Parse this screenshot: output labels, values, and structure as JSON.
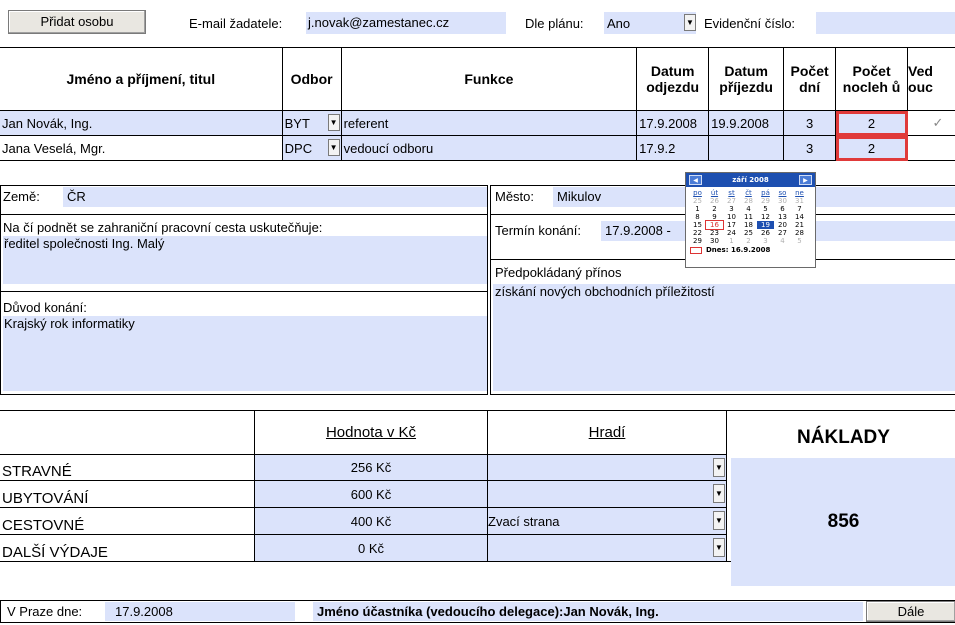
{
  "top": {
    "add_person_label": "Přidat osobu",
    "email_label": "E-mail žadatele:",
    "email_value": "j.novak@zamestanec.cz",
    "plan_label": "Dle plánu:",
    "plan_value": "Ano",
    "record_label": "Evidenční číslo:",
    "record_value": ""
  },
  "people": {
    "headers": {
      "name": "Jméno a příjmení, titul",
      "dept": "Odbor",
      "role": "Funkce",
      "depart_1": "Datum",
      "depart_2": "odjezdu",
      "arrive_1": "Datum",
      "arrive_2": "příjezdu",
      "days_1": "Počet",
      "days_2": "dní",
      "nights_1": "Počet",
      "nights_2": "nocleh ů",
      "last_1": "Ved",
      "last_2": "ouc"
    },
    "rows": [
      {
        "name": "Jan Novák, Ing.",
        "dept": "BYT",
        "role": "referent",
        "depart": "17.9.2008",
        "arrive": "19.9.2008",
        "days": "3",
        "nights": "2",
        "check": "✓"
      },
      {
        "name": "Jana Veselá, Mgr.",
        "dept": "DPC",
        "role": "vedoucí odboru",
        "depart": "17.9.2",
        "arrive": "",
        "days": "3",
        "nights": "2",
        "check": ""
      }
    ]
  },
  "calendar": {
    "month": "září 2008",
    "weekdays": [
      "po",
      "út",
      "st",
      "čt",
      "pá",
      "so",
      "ne"
    ],
    "days": [
      [
        "25",
        "g"
      ],
      [
        "26",
        "g"
      ],
      [
        "27",
        "g"
      ],
      [
        "28",
        "g"
      ],
      [
        "29",
        "g"
      ],
      [
        "30",
        "g"
      ],
      [
        "31",
        "g"
      ],
      [
        "1",
        ""
      ],
      [
        "2",
        ""
      ],
      [
        "3",
        ""
      ],
      [
        "4",
        ""
      ],
      [
        "5",
        ""
      ],
      [
        "6",
        ""
      ],
      [
        "7",
        ""
      ],
      [
        "8",
        ""
      ],
      [
        "9",
        ""
      ],
      [
        "10",
        ""
      ],
      [
        "11",
        ""
      ],
      [
        "12",
        ""
      ],
      [
        "13",
        ""
      ],
      [
        "14",
        ""
      ],
      [
        "15",
        ""
      ],
      [
        "16",
        "t"
      ],
      [
        "17",
        ""
      ],
      [
        "18",
        ""
      ],
      [
        "19",
        "s"
      ],
      [
        "20",
        ""
      ],
      [
        "21",
        ""
      ],
      [
        "22",
        ""
      ],
      [
        "23",
        ""
      ],
      [
        "24",
        ""
      ],
      [
        "25",
        ""
      ],
      [
        "26",
        ""
      ],
      [
        "27",
        ""
      ],
      [
        "28",
        ""
      ],
      [
        "29",
        ""
      ],
      [
        "30",
        ""
      ],
      [
        "1",
        "g"
      ],
      [
        "2",
        "g"
      ],
      [
        "3",
        "g"
      ],
      [
        "4",
        "g"
      ],
      [
        "5",
        "g"
      ]
    ],
    "today_label": "Dnes: 16.9.2008"
  },
  "trip": {
    "country_label": "Země:",
    "country_value": "ČR",
    "city_label": "Město:",
    "city_value": "Mikulov",
    "initiator_label": "Na čí podnět se zahraniční pracovní cesta uskutečňuje:",
    "initiator_value": "ředitel společnosti Ing. Malý",
    "term_label": "Termín konání:",
    "term_value": "17.9.2008 -",
    "benefit_label": "Předpokládaný přínos",
    "benefit_value": "získání nových obchodních příležitostí",
    "reason_label": "Důvod konání:",
    "reason_value": "Krajský rok informatiky"
  },
  "costs": {
    "value_header": "Hodnota v Kč",
    "payer_header": "Hradí",
    "total_header": "NÁKLADY",
    "total_value": "856",
    "rows": [
      {
        "label": "STRAVNÉ",
        "value": "256 Kč",
        "payer": ""
      },
      {
        "label": "UBYTOVÁNÍ",
        "value": "600 Kč",
        "payer": ""
      },
      {
        "label": "CESTOVNÉ",
        "value": "400 Kč",
        "payer": "Zvací strana"
      },
      {
        "label": "DALŠÍ VÝDAJE",
        "value": "0 Kč",
        "payer": ""
      }
    ]
  },
  "footer": {
    "place_label": "V Praze dne:",
    "date_value": "17.9.2008",
    "participant_label": "Jméno účastníka (vedoucího delegace):Jan Novák, Ing.",
    "next_label": "Dále"
  }
}
